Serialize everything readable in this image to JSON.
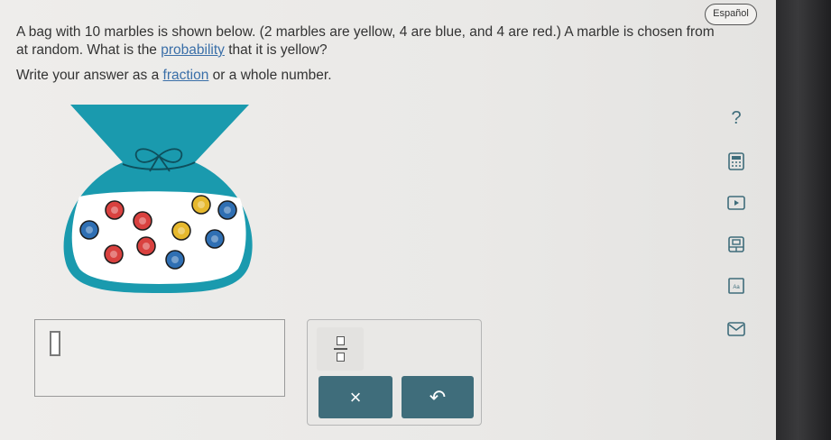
{
  "language_button": "Español",
  "question": {
    "line1_a": "A bag with ",
    "count": "10",
    "line1_b": " marbles is shown below. (2 marbles are yellow, 4 are blue, and 4 are red.) A marble is chosen from",
    "line2_a": "at random. What is the ",
    "probability_link": "probability",
    "line2_b": " that it is yellow?"
  },
  "instruction": {
    "prefix": "Write your answer as a ",
    "fraction_link": "fraction",
    "suffix": " or a whole number."
  },
  "bag": {
    "bag_color": "#1a9aae",
    "liquid_color": "#ffffff",
    "marbles": [
      {
        "color": "red"
      },
      {
        "color": "red"
      },
      {
        "color": "yellow"
      },
      {
        "color": "blue"
      },
      {
        "color": "blue"
      },
      {
        "color": "red"
      },
      {
        "color": "yellow"
      },
      {
        "color": "blue"
      },
      {
        "color": "red"
      },
      {
        "color": "blue"
      }
    ]
  },
  "keypad": {
    "clear_label": "×",
    "undo_label": "↶"
  },
  "tools": {
    "help_label": "?"
  },
  "colors": {
    "accent": "#3f6d7b",
    "link": "#3a6fa8",
    "red": "#d9413f",
    "blue": "#2f6fb3",
    "yellow": "#e6b82d"
  }
}
